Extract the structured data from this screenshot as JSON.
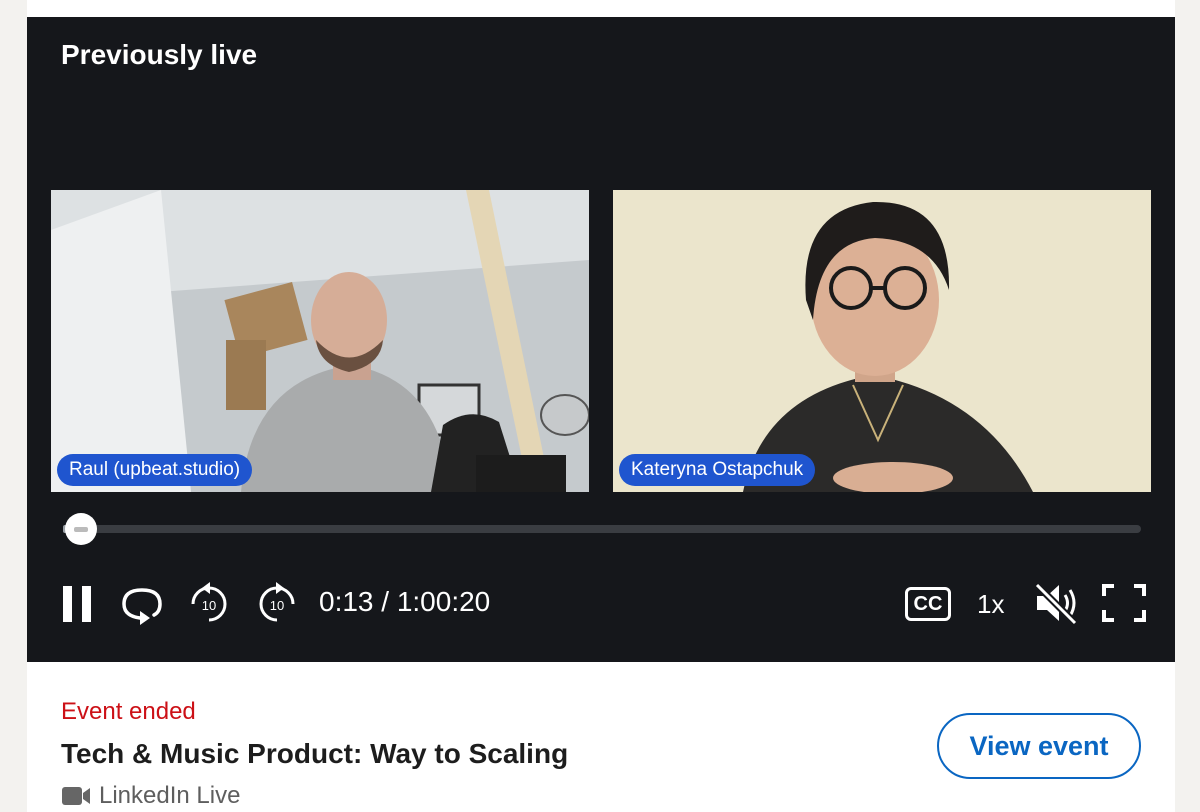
{
  "player": {
    "title": "Previously live",
    "participants": [
      {
        "name": "Raul (upbeat.studio)"
      },
      {
        "name": "Kateryna Ostapchuk"
      }
    ],
    "time_display": "0:13 / 1:00:20",
    "progress_fraction": 0.004,
    "speed_label": "1x",
    "cc_label": "CC",
    "icons": [
      "pause-icon",
      "loop-icon",
      "rewind-10-icon",
      "forward-10-icon",
      "cc-icon",
      "mute-icon",
      "fullscreen-icon"
    ]
  },
  "event": {
    "status": "Event ended",
    "title": "Tech & Music Product: Way to Scaling",
    "source": "LinkedIn Live",
    "view_button": "View event"
  },
  "colors": {
    "player_bg": "#15171b",
    "name_tag": "#1f55cf",
    "status_red": "#cc1016",
    "link_blue": "#0a66c2"
  }
}
